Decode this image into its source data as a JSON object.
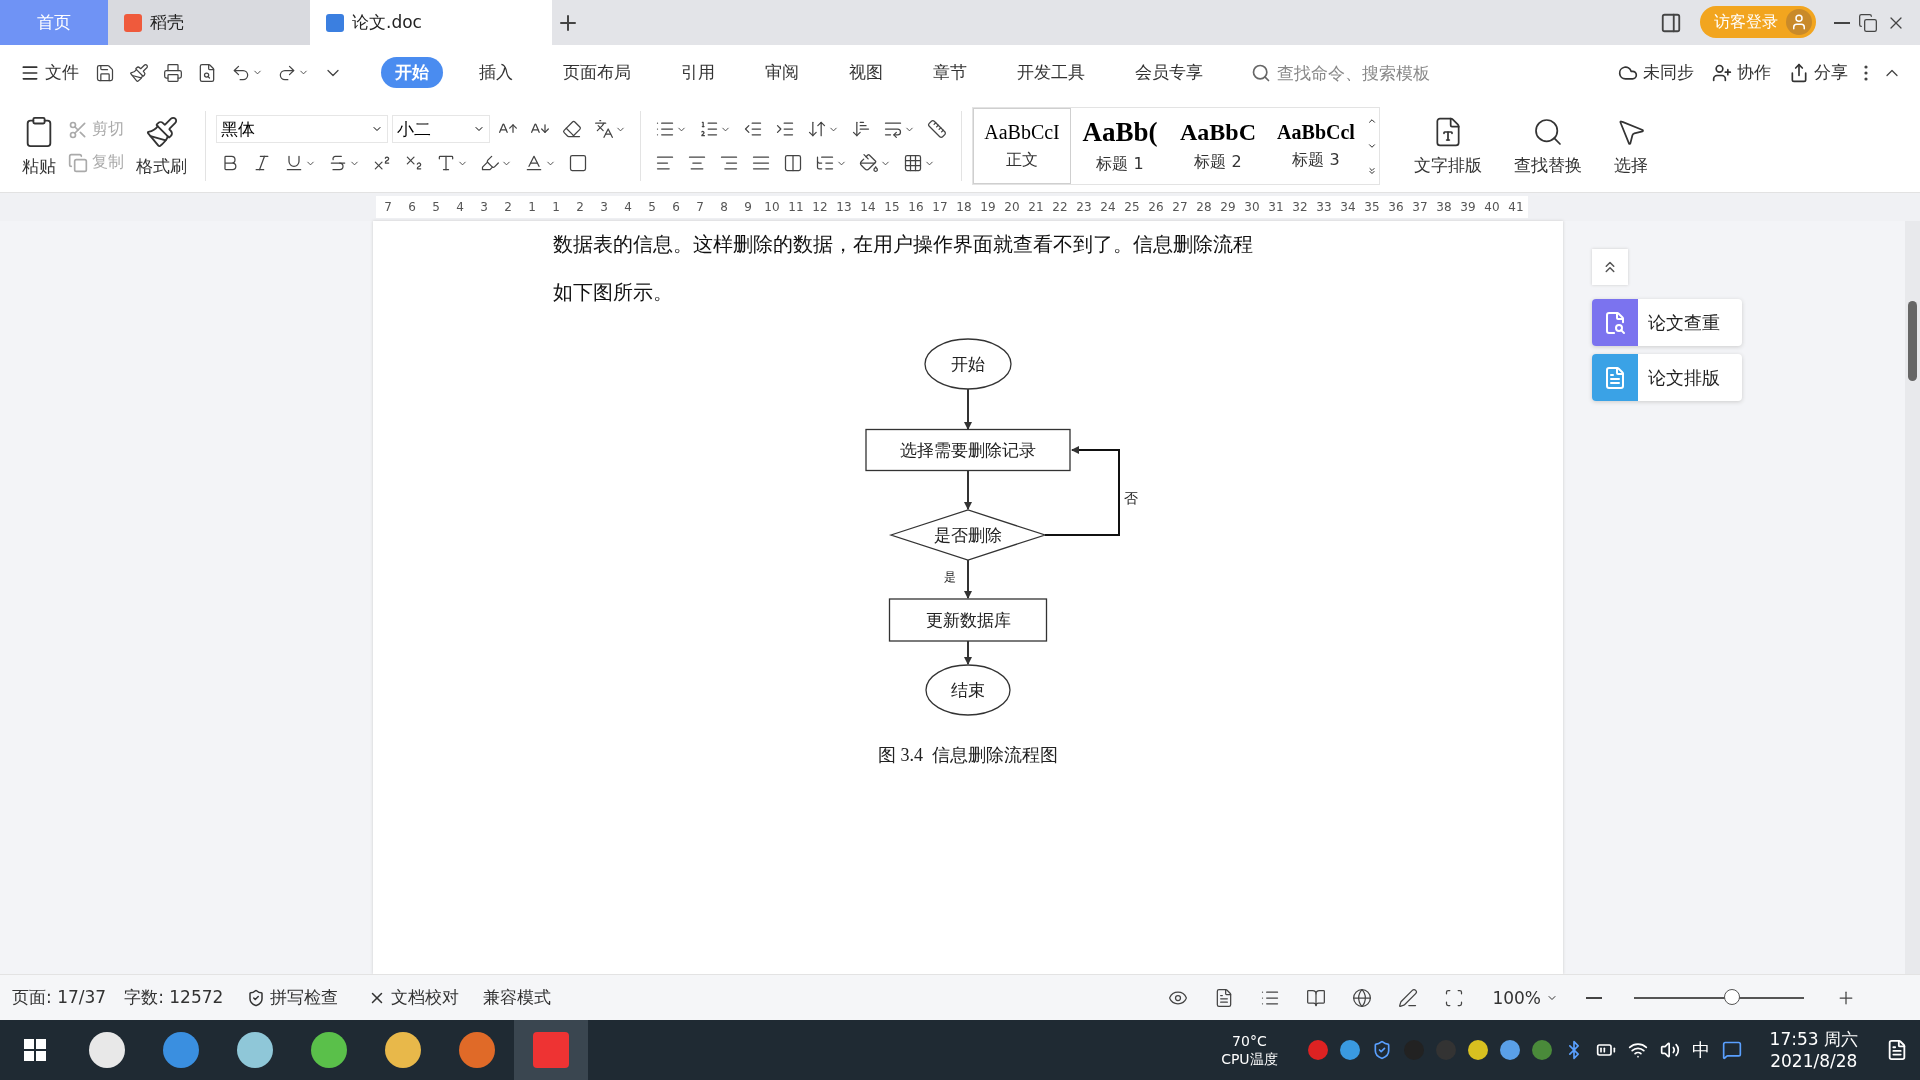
{
  "tabs": [
    {
      "label": "首页",
      "kind": "home",
      "selected": false
    },
    {
      "label": "稻壳",
      "kind": "app",
      "selected": false
    },
    {
      "label": "论文.doc",
      "kind": "doc",
      "selected": true
    }
  ],
  "title_bar": {
    "login": "访客登录"
  },
  "menu": {
    "file": "文件",
    "tabs": [
      {
        "label": "开始",
        "selected": true
      },
      {
        "label": "插入",
        "selected": false
      },
      {
        "label": "页面布局",
        "selected": false
      },
      {
        "label": "引用",
        "selected": false
      },
      {
        "label": "审阅",
        "selected": false
      },
      {
        "label": "视图",
        "selected": false
      },
      {
        "label": "章节",
        "selected": false
      },
      {
        "label": "开发工具",
        "selected": false
      },
      {
        "label": "会员专享",
        "selected": false
      }
    ],
    "search": {
      "placeholder": "查找命令、搜索模板"
    },
    "actions": [
      {
        "kind": "sync",
        "label": "未同步"
      },
      {
        "kind": "collab",
        "label": "协作"
      },
      {
        "kind": "share",
        "label": "分享"
      }
    ]
  },
  "ribbon": {
    "paste": "粘贴",
    "cut": {
      "label": "剪切",
      "disabled": true
    },
    "copy": {
      "label": "复制",
      "disabled": true
    },
    "format_painter": "格式刷",
    "font": {
      "name": "黑体",
      "size": "小二"
    },
    "styles": [
      {
        "sample": "AaBbCcI",
        "label": "正文",
        "kind": "normal",
        "selected": true
      },
      {
        "sample": "AaBb(",
        "label": "标题 1",
        "kind": "h1",
        "selected": false
      },
      {
        "sample": "AaBbC",
        "label": "标题 2",
        "kind": "h2",
        "selected": false
      },
      {
        "sample": "AaBbCcl",
        "label": "标题 3",
        "kind": "h3",
        "selected": false
      }
    ],
    "tools": [
      {
        "kind": "layout",
        "label": "文字排版"
      },
      {
        "kind": "find",
        "label": "查找替换"
      },
      {
        "kind": "select",
        "label": "选择"
      }
    ]
  },
  "ruler": [
    "7",
    "6",
    "5",
    "4",
    "3",
    "2",
    "1",
    "1",
    "2",
    "3",
    "4",
    "5",
    "6",
    "7",
    "8",
    "9",
    "10",
    "11",
    "12",
    "13",
    "14",
    "15",
    "16",
    "17",
    "18",
    "19",
    "20",
    "21",
    "22",
    "23",
    "24",
    "25",
    "26",
    "27",
    "28",
    "29",
    "30",
    "31",
    "32",
    "33",
    "34",
    "35",
    "36",
    "37",
    "38",
    "39",
    "40",
    "41"
  ],
  "document": {
    "paragraphs": [
      "数据表的信息。这样删除的数据，在用户操作界面就查看不到了。信息删除流程",
      "如下图所示。"
    ],
    "flowchart": {
      "nodes": [
        {
          "kind": "terminal",
          "label": "开始"
        },
        {
          "kind": "process",
          "label": "选择需要删除记录"
        },
        {
          "kind": "decision",
          "label": "是否删除"
        },
        {
          "kind": "process",
          "label": "更新数据库"
        },
        {
          "kind": "terminal",
          "label": "结束"
        }
      ],
      "no_label": "否",
      "yes_label": "是"
    },
    "caption": "图 3.4  信息删除流程图"
  },
  "side_panel": [
    {
      "label": "论文查重",
      "kind": "check",
      "color": "#7b73ef"
    },
    {
      "label": "论文排版",
      "kind": "format",
      "color": "#3aa2e6"
    }
  ],
  "status_bar": {
    "page": "页面: 17/37",
    "words": "字数: 12572",
    "spell": "拼写检查",
    "proof": "文档校对",
    "mode": "兼容模式",
    "zoom": "100%",
    "zoom_slider": {
      "level": 0.58
    }
  },
  "taskbar": {
    "cpu_temp": "70°C",
    "cpu_label": "CPU温度",
    "ime": "中",
    "time": "17:53 周六",
    "date": "2021/8/28"
  }
}
